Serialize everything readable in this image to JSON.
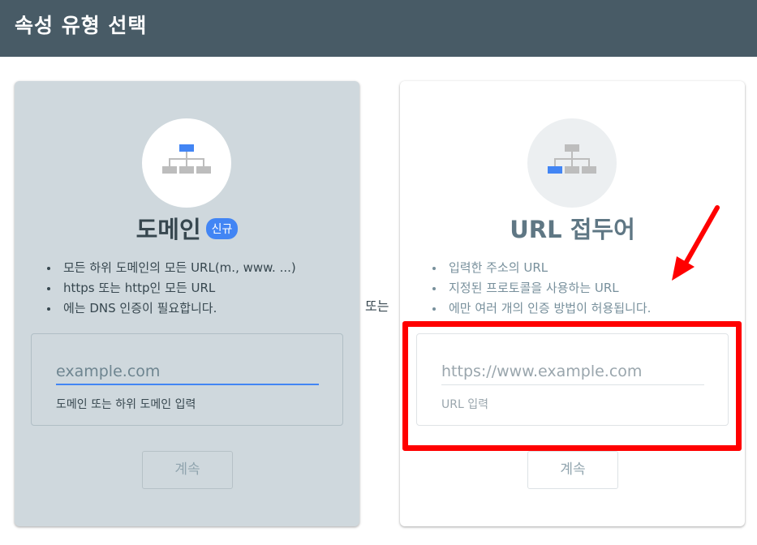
{
  "header": {
    "title": "속성 유형 선택"
  },
  "domain_card": {
    "title": "도메인",
    "badge": "신규",
    "bullets": [
      "모든 하위 도메인의 모든 URL(m., www. ...)",
      "https 또는 http인 모든 URL",
      "에는 DNS 인증이 필요합니다."
    ],
    "input_placeholder": "example.com",
    "input_hint": "도메인 또는 하위 도메인 입력",
    "continue_label": "계속"
  },
  "or_label": "또는",
  "url_card": {
    "title": "URL 접두어",
    "bullets": [
      "입력한 주소의 URL",
      "지정된 프로토콜을 사용하는 URL",
      "에만 여러 개의 인증 방법이 허용됩니다."
    ],
    "input_placeholder": "https://www.example.com",
    "input_hint": "URL 입력",
    "continue_label": "계속"
  },
  "colors": {
    "header_bg": "#485b66",
    "accent_blue": "#4285f4",
    "highlight_red": "#ff0000"
  },
  "icons": {
    "domain_icon": "sitemap-icon",
    "url_icon": "sitemap-icon",
    "annotation": "red-arrow-icon"
  }
}
